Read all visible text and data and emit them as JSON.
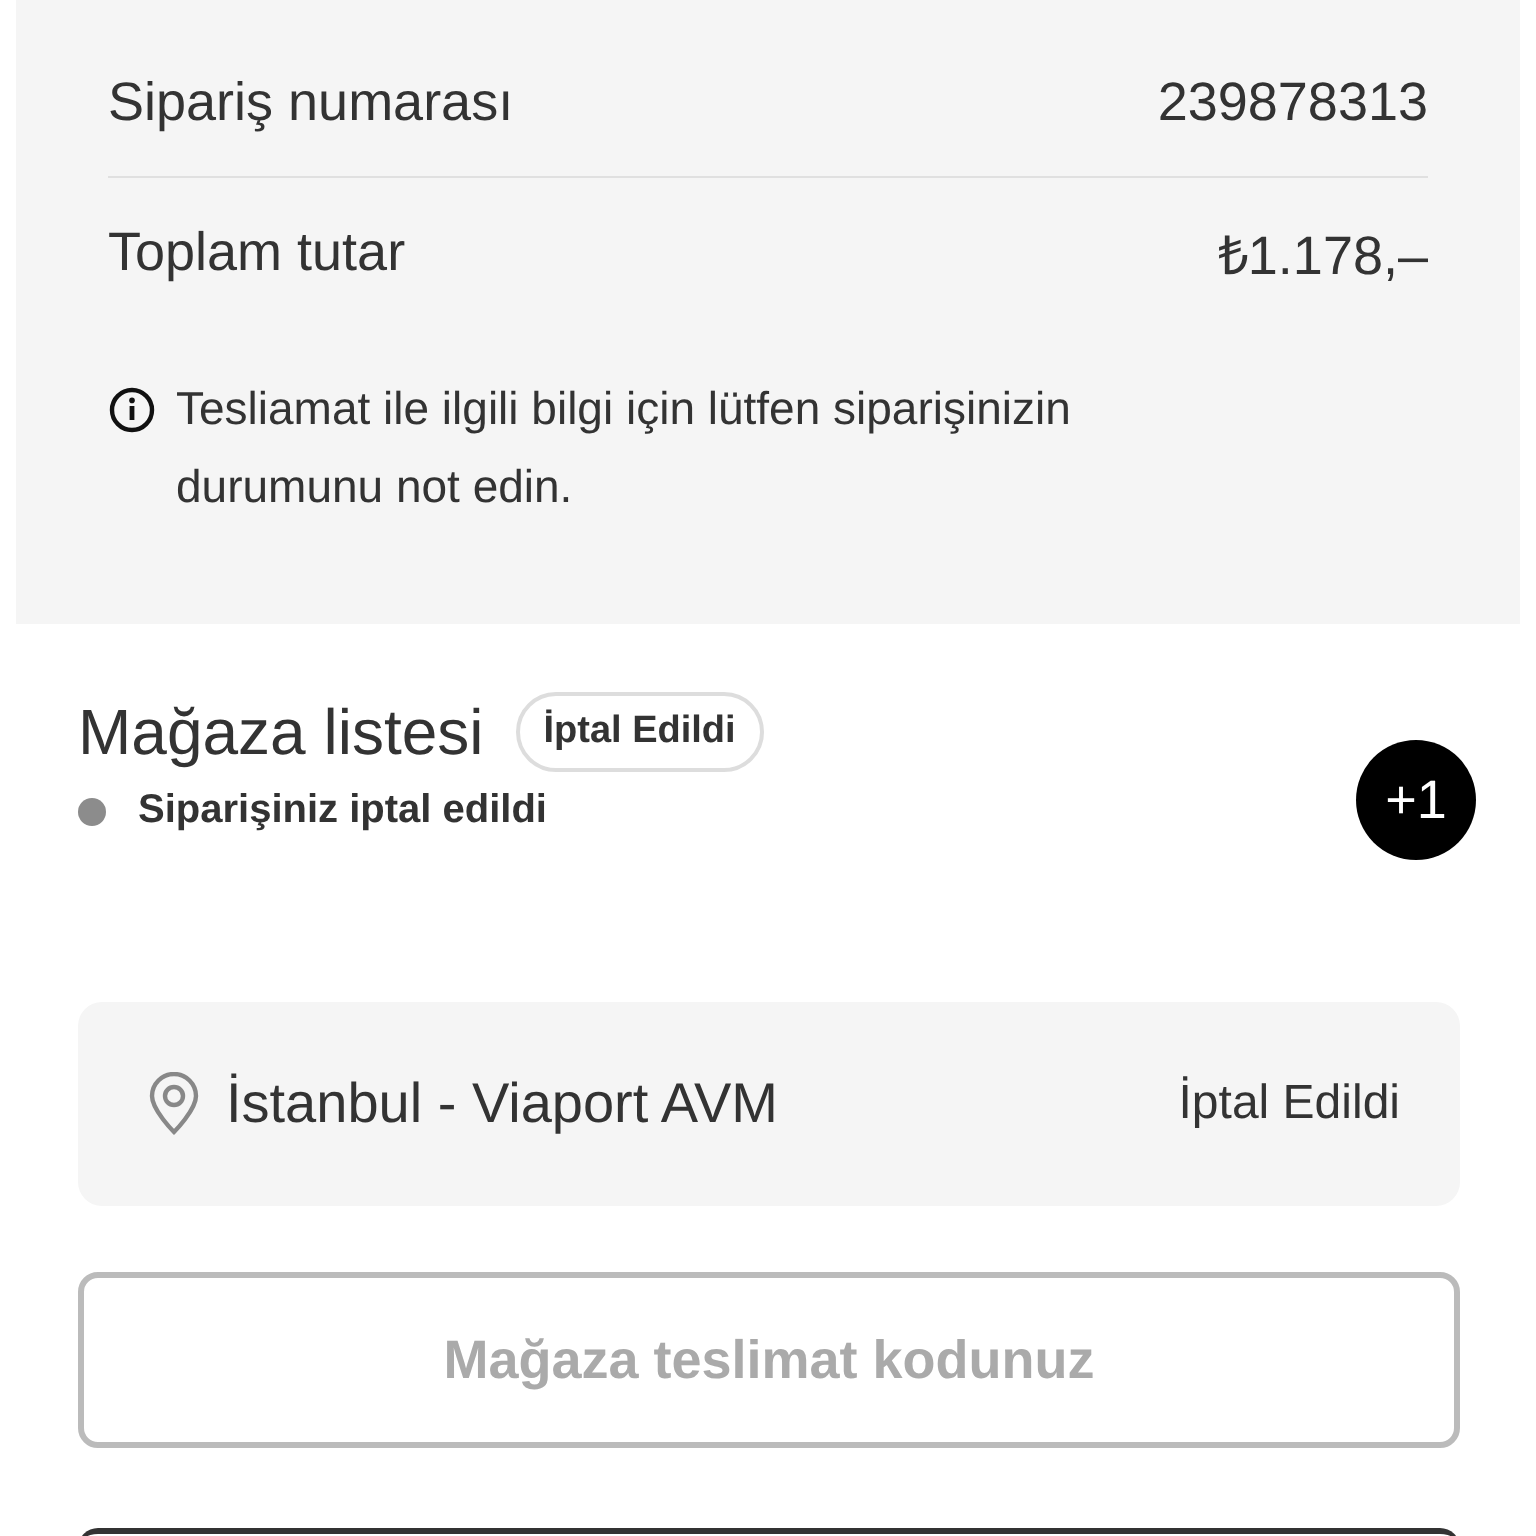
{
  "summary": {
    "rows": [
      {
        "label": "Sipariş numarası",
        "value": "239878313"
      },
      {
        "label": "Toplam tutar",
        "value": "₺1.178,–"
      }
    ],
    "info": "Tesliamat ile ilgili bilgi için lütfen siparişinizin durumunu not edin."
  },
  "stores": {
    "title": "Mağaza listesi",
    "badge": "İptal Edildi",
    "status": {
      "text": "Siparişiniz iptal edildi",
      "color": "#8c8c8c"
    },
    "counter": "+1",
    "items": [
      {
        "name": "İstanbul - Viaport AVM",
        "status": "İptal Edildi"
      }
    ]
  },
  "code_button": {
    "label": "Mağaza teslimat kodunuz",
    "disabled": true
  }
}
